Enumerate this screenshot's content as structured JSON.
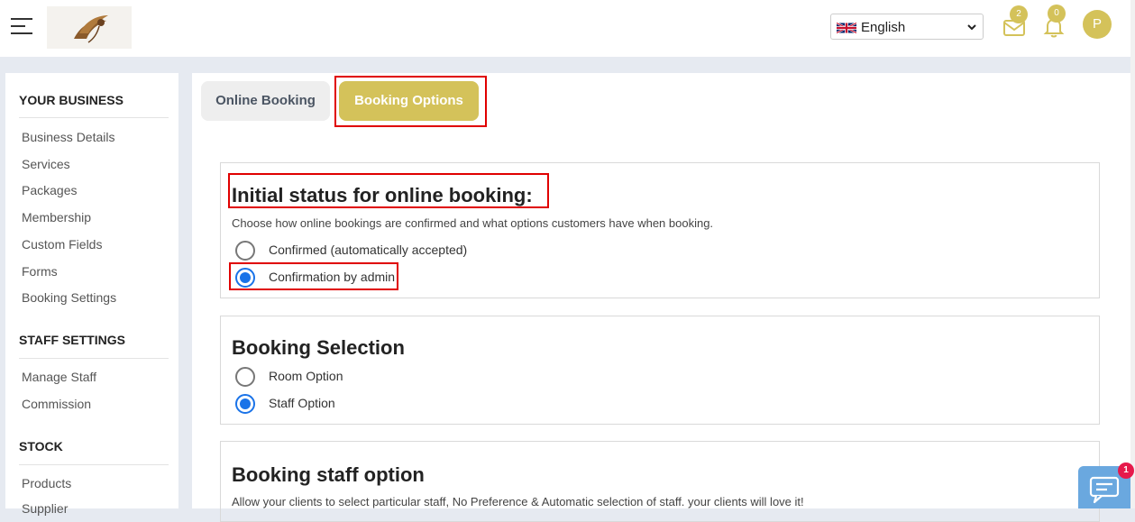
{
  "header": {
    "language": "English",
    "mail_count": "2",
    "notification_count": "0",
    "avatar_initial": "P",
    "brand_color": "#d4c25a"
  },
  "sidebar": {
    "sections": [
      {
        "title": "YOUR BUSINESS",
        "items": [
          "Business Details",
          "Services",
          "Packages",
          "Membership",
          "Custom Fields",
          "Forms",
          "Booking Settings"
        ]
      },
      {
        "title": "STAFF SETTINGS",
        "items": [
          "Manage Staff",
          "Commission"
        ]
      },
      {
        "title": "STOCK",
        "items": [
          "Products",
          "Supplier"
        ]
      }
    ]
  },
  "tabs": {
    "online_booking": "Online Booking",
    "booking_options": "Booking Options",
    "active": "booking_options"
  },
  "cards": {
    "initial_status": {
      "title": "Initial status for online booking:",
      "description": "Choose how online bookings are confirmed and what options customers have when booking.",
      "options": [
        "Confirmed (automatically accepted)",
        "Confirmation by admin"
      ],
      "selected": "Confirmation by admin"
    },
    "booking_selection": {
      "title": "Booking Selection",
      "options": [
        "Room Option",
        "Staff Option"
      ],
      "selected": "Staff Option"
    },
    "booking_staff": {
      "title": "Booking staff option",
      "description": "Allow your clients to select particular staff, No Preference & Automatic selection of staff. your clients will love it!"
    }
  },
  "chat": {
    "unread": "1"
  },
  "icons": [
    "hamburger-icon",
    "logo",
    "uk-flag-icon",
    "chevron-down-icon",
    "mail-icon",
    "bell-icon",
    "chat-icon"
  ],
  "highlight_color": "#e00000",
  "accent_color": "#1a73e8"
}
